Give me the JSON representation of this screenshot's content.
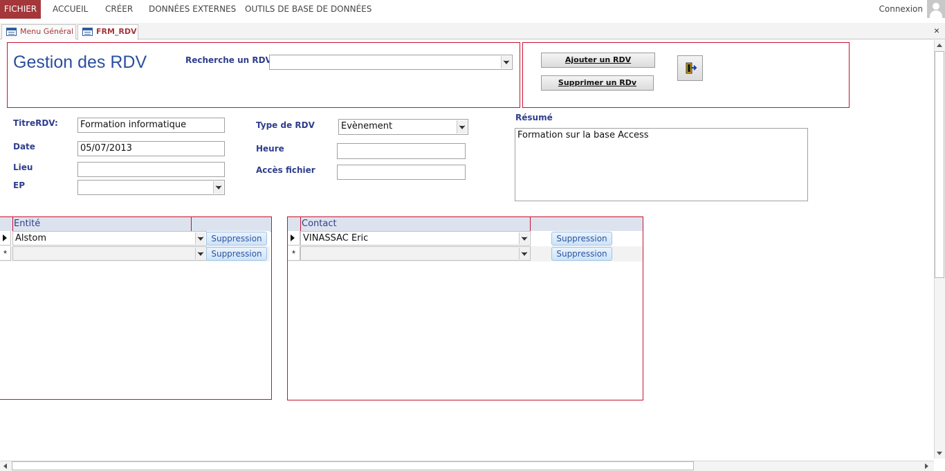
{
  "ribbon": {
    "tabs": [
      "FICHIER",
      "ACCUEIL",
      "CRÉER",
      "DONNÉES EXTERNES",
      "OUTILS DE BASE DE DONNÉES"
    ],
    "signin": "Connexion"
  },
  "doc_tabs": [
    {
      "label": "Menu Général",
      "icon": "form-icon"
    },
    {
      "label": "FRM_RDV",
      "icon": "form-icon"
    }
  ],
  "header": {
    "title": "Gestion des RDV",
    "search_label": "Recherche  un RDV :",
    "search_value": "",
    "add_button": "Ajouter un RDV",
    "delete_button": "Supprimer un RDv",
    "exit_icon": "exit-door-icon"
  },
  "form": {
    "titre_label": "TitreRDV:",
    "titre_value": "Formation informatique",
    "date_label": "Date",
    "date_value": "05/07/2013",
    "lieu_label": "Lieu",
    "lieu_value": "",
    "ep_label": "EP",
    "ep_value": "",
    "type_label": "Type de RDV",
    "type_value": "Evènement",
    "heure_label": "Heure",
    "heure_value": "",
    "acces_label": "Accès fichier",
    "acces_value": "",
    "resume_label": "Résumé",
    "resume_value": "Formation sur la base Access"
  },
  "entite_subform": {
    "header": "Entité",
    "rows": [
      {
        "value": "Alstom",
        "button": "Suppression"
      },
      {
        "value": "",
        "button": "Suppression"
      }
    ],
    "new_row_marker": "*"
  },
  "contact_subform": {
    "header": "Contact",
    "rows": [
      {
        "value": "VINASSAC Eric",
        "button": "Suppression"
      },
      {
        "value": "",
        "button": "Suppression"
      }
    ],
    "new_row_marker": "*"
  },
  "window": {
    "close_glyph": "×"
  },
  "colors": {
    "accent": "#a4373a",
    "label": "#2e3e8c",
    "frame": "#c8102e"
  }
}
